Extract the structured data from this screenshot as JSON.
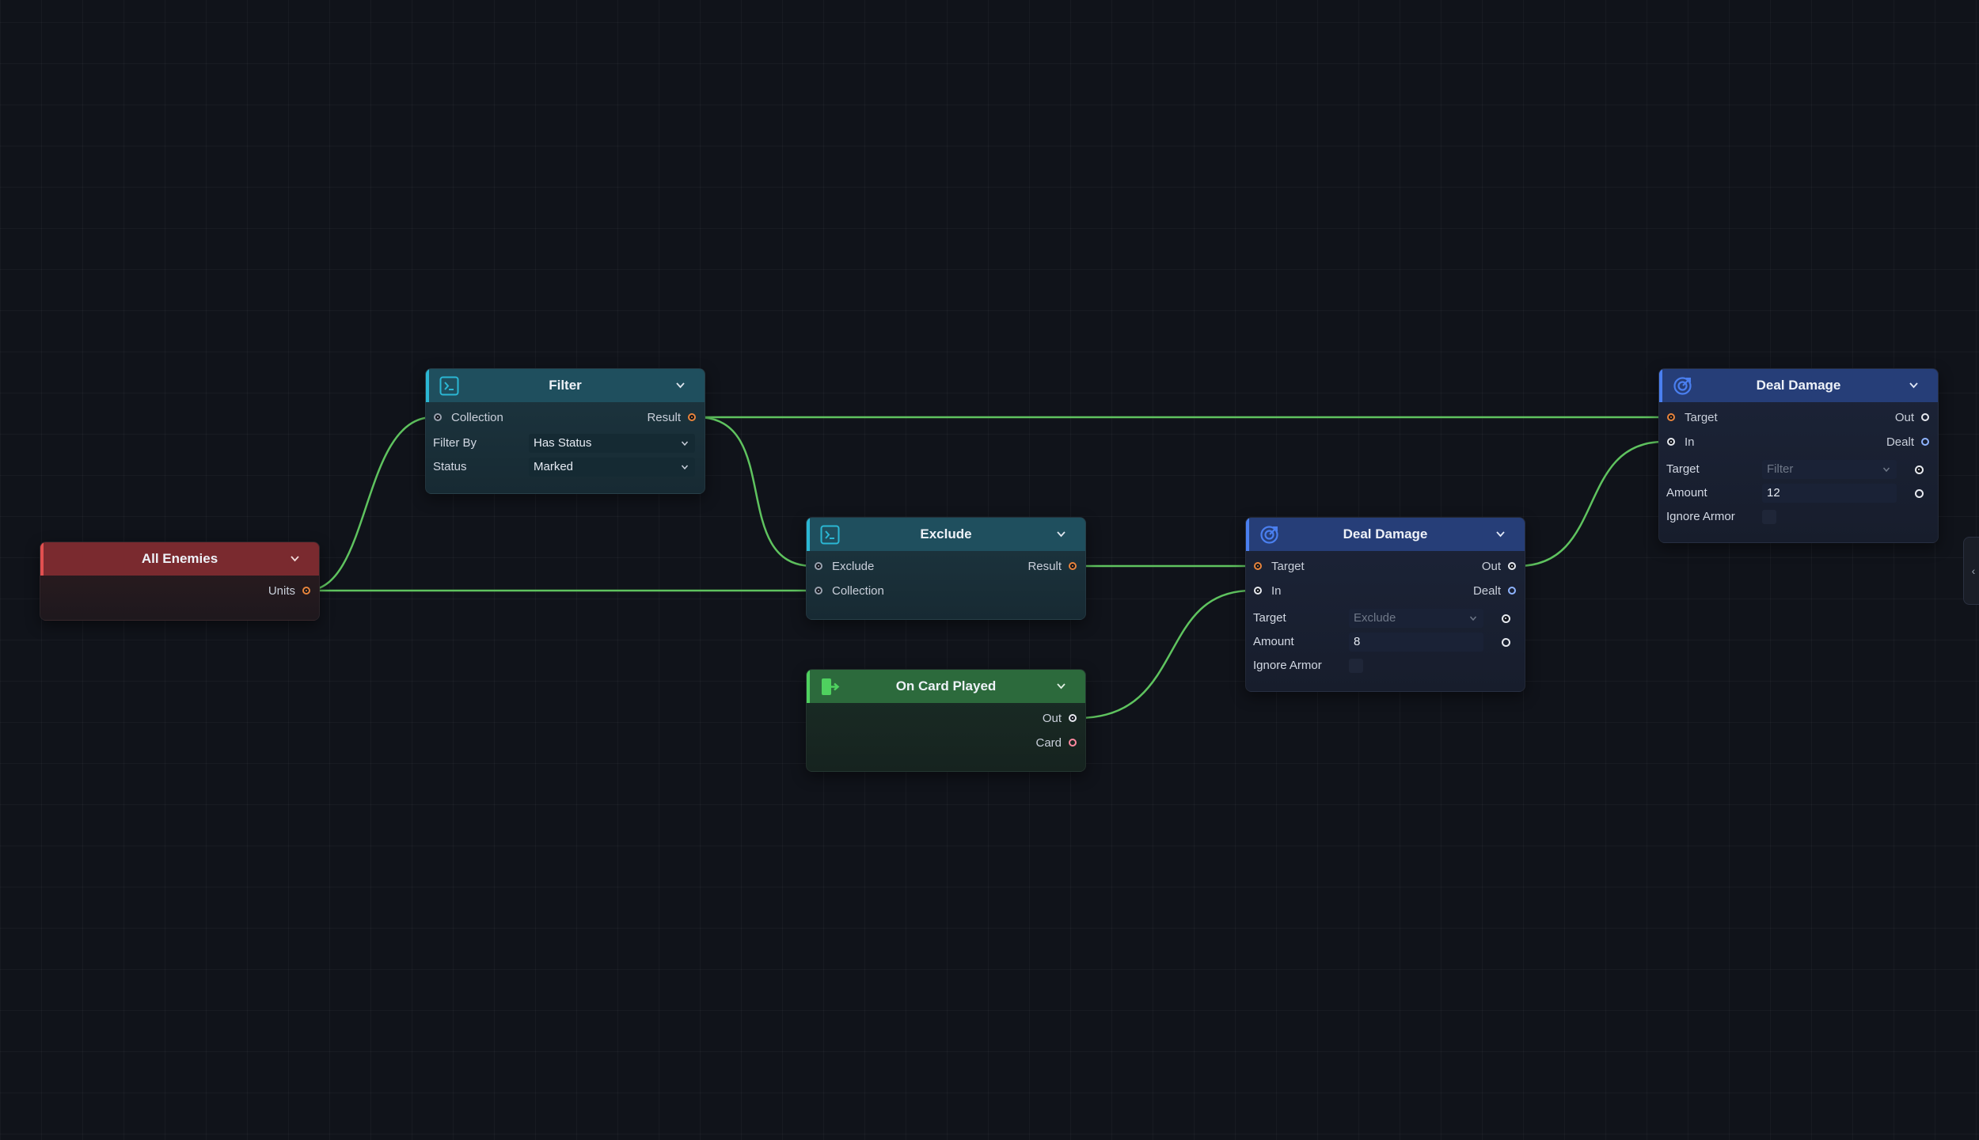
{
  "canvas": {
    "nodes": {
      "filter": {
        "title": "Filter",
        "inputs": [
          "Collection"
        ],
        "outputs": [
          "Result"
        ],
        "fields": [
          {
            "label": "Filter By",
            "value": "Has Status"
          },
          {
            "label": "Status",
            "value": "Marked"
          }
        ]
      },
      "all_enemies": {
        "title": "All Enemies",
        "outputs": [
          "Units"
        ]
      },
      "exclude": {
        "title": "Exclude",
        "inputs": [
          "Exclude",
          "Collection"
        ],
        "outputs": [
          "Result"
        ]
      },
      "on_card_played": {
        "title": "On Card Played",
        "outputs": [
          "Out",
          "Card"
        ]
      },
      "deal_damage_1": {
        "title": "Deal Damage",
        "inputs": [
          "Target",
          "In"
        ],
        "outputs": [
          "Out",
          "Dealt"
        ],
        "fields": [
          {
            "label": "Target",
            "value": "Exclude"
          },
          {
            "label": "Amount",
            "value": "8"
          },
          {
            "label": "Ignore Armor",
            "value": ""
          }
        ]
      },
      "deal_damage_2": {
        "title": "Deal Damage",
        "inputs": [
          "Target",
          "In"
        ],
        "outputs": [
          "Out",
          "Dealt"
        ],
        "fields": [
          {
            "label": "Target",
            "value": "Filter"
          },
          {
            "label": "Amount",
            "value": "12"
          },
          {
            "label": "Ignore Armor",
            "value": ""
          }
        ]
      }
    },
    "connections": [
      {
        "from": "All Enemies.Units",
        "to": "Filter.Collection"
      },
      {
        "from": "All Enemies.Units",
        "to": "Exclude.Collection"
      },
      {
        "from": "Filter.Result",
        "to": "Exclude.Exclude"
      },
      {
        "from": "Filter.Result",
        "to": "Deal Damage (2).Target"
      },
      {
        "from": "Exclude.Result",
        "to": "Deal Damage (1).Target"
      },
      {
        "from": "On Card Played.Out",
        "to": "Deal Damage (1).In"
      },
      {
        "from": "Deal Damage (1).Out",
        "to": "Deal Damage (2).In"
      }
    ],
    "colors": {
      "wire": "#5fc35f",
      "filter_header": "#1f4f5e",
      "source_header": "#7a2a2f",
      "event_header": "#2c6a3c",
      "action_header": "#263e78"
    }
  },
  "side_panel": {
    "collapse_icon": "‹"
  }
}
